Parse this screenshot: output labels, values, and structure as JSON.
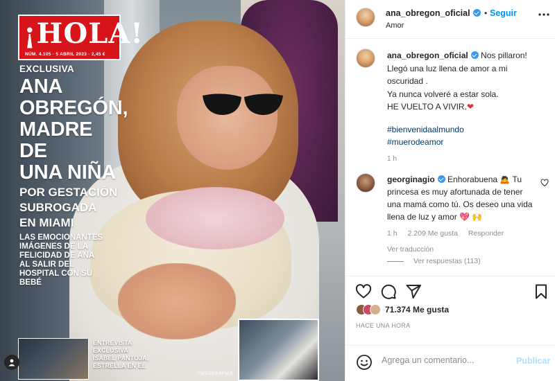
{
  "cover": {
    "logo": "¡HOLA!",
    "issue_line": "NÚM. 4.105 · 5 ABRIL 2023 · 2,45 €",
    "kicker": "EXCLUSIVA",
    "headline_lines": [
      "ANA",
      "OBREGÓN,",
      "MADRE DE",
      "UNA NIÑA"
    ],
    "subhead_lines": [
      "POR GESTACIÓN",
      "SUBROGADA",
      "EN MIAMI"
    ],
    "deck_lines": [
      "LAS EMOCIONANTES",
      "IMÁGENES DE LA",
      "FELICIDAD DE ANA",
      "AL SALIR DEL",
      "HOSPITAL CON SU",
      "BEBÉ"
    ],
    "inset_left_lines": [
      "ENTREVISTA",
      "EXCLUSIVA",
      "ISABEL PANTOJA,",
      "ESTRELLA EN EL"
    ],
    "photo_credit": "FOTOGRAFÍAS"
  },
  "header": {
    "username": "ana_obregon_oficial",
    "separator": "•",
    "follow_label": "Seguir",
    "subtitle": "Amor",
    "more_icon": "more-horizontal-icon"
  },
  "caption": {
    "username": "ana_obregon_oficial",
    "text_first": "Nos pillaron!",
    "lines": [
      "Llegó una luz llena de amor a mi",
      "oscuridad .",
      "Ya nunca volveré a estar sola.",
      "HE VUELTO A VIVIR."
    ],
    "heart": "❤",
    "hashtags": [
      "#bienvenidaalmundo",
      "#muerodeamor"
    ],
    "time": "1 h"
  },
  "comment": {
    "username": "georginagio",
    "text": "Enhorabuena 🙇 Tu princesa es muy afortunada de tener una mamá como tú. Os deseo una vida llena de luz y amor 💖 🙌",
    "time": "1 h",
    "likes": "2.209 Me gusta",
    "reply_label": "Responder",
    "translate_label": "Ver traducción",
    "view_replies": "Ver respuestas (113)"
  },
  "actions": {
    "likes_count": "71.374",
    "likes_suffix": "Me gusta",
    "time": "HACE UNA HORA"
  },
  "add_comment": {
    "placeholder": "Agrega un comentario...",
    "publish_label": "Publicar"
  },
  "colors": {
    "accent": "#0095f6",
    "verified": "#3897f0",
    "hola_red": "#d7141a",
    "publish_disabled": "#b2dffc"
  }
}
